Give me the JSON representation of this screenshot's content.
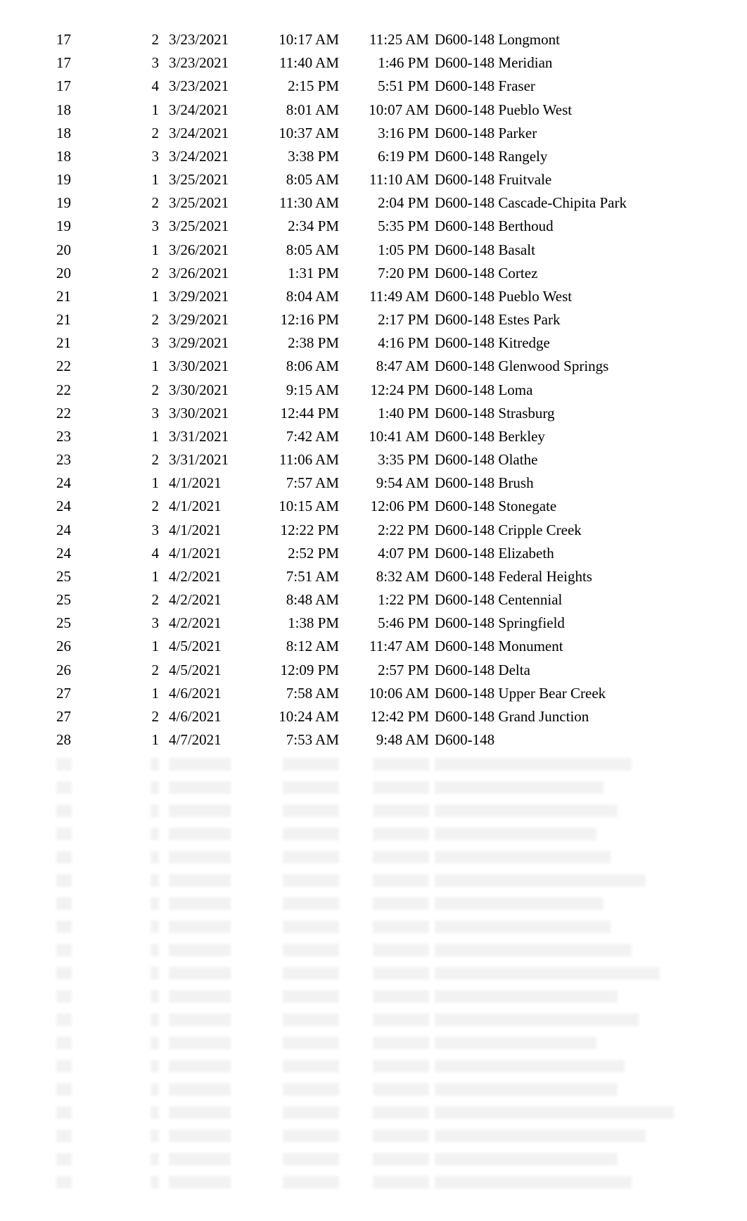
{
  "rows": [
    {
      "a": "17",
      "b": "2",
      "c": "3/23/2021",
      "d": "10:17 AM",
      "e": "11:25 AM",
      "f": "D600-148 Longmont"
    },
    {
      "a": "17",
      "b": "3",
      "c": "3/23/2021",
      "d": "11:40 AM",
      "e": "1:46 PM",
      "f": "D600-148 Meridian"
    },
    {
      "a": "17",
      "b": "4",
      "c": "3/23/2021",
      "d": "2:15 PM",
      "e": "5:51 PM",
      "f": "D600-148 Fraser"
    },
    {
      "a": "18",
      "b": "1",
      "c": "3/24/2021",
      "d": "8:01 AM",
      "e": "10:07 AM",
      "f": "D600-148 Pueblo West"
    },
    {
      "a": "18",
      "b": "2",
      "c": "3/24/2021",
      "d": "10:37 AM",
      "e": "3:16 PM",
      "f": "D600-148 Parker"
    },
    {
      "a": "18",
      "b": "3",
      "c": "3/24/2021",
      "d": "3:38 PM",
      "e": "6:19 PM",
      "f": "D600-148 Rangely"
    },
    {
      "a": "19",
      "b": "1",
      "c": "3/25/2021",
      "d": "8:05 AM",
      "e": "11:10 AM",
      "f": "D600-148 Fruitvale"
    },
    {
      "a": "19",
      "b": "2",
      "c": "3/25/2021",
      "d": "11:30 AM",
      "e": "2:04 PM",
      "f": "D600-148 Cascade-Chipita Park"
    },
    {
      "a": "19",
      "b": "3",
      "c": "3/25/2021",
      "d": "2:34 PM",
      "e": "5:35 PM",
      "f": "D600-148 Berthoud"
    },
    {
      "a": "20",
      "b": "1",
      "c": "3/26/2021",
      "d": "8:05 AM",
      "e": "1:05 PM",
      "f": "D600-148 Basalt"
    },
    {
      "a": "20",
      "b": "2",
      "c": "3/26/2021",
      "d": "1:31 PM",
      "e": "7:20 PM",
      "f": "D600-148 Cortez"
    },
    {
      "a": "21",
      "b": "1",
      "c": "3/29/2021",
      "d": "8:04 AM",
      "e": "11:49 AM",
      "f": "D600-148 Pueblo West"
    },
    {
      "a": "21",
      "b": "2",
      "c": "3/29/2021",
      "d": "12:16 PM",
      "e": "2:17 PM",
      "f": "D600-148 Estes Park"
    },
    {
      "a": "21",
      "b": "3",
      "c": "3/29/2021",
      "d": "2:38 PM",
      "e": "4:16 PM",
      "f": "D600-148 Kitredge"
    },
    {
      "a": "22",
      "b": "1",
      "c": "3/30/2021",
      "d": "8:06 AM",
      "e": "8:47 AM",
      "f": "D600-148 Glenwood Springs"
    },
    {
      "a": "22",
      "b": "2",
      "c": "3/30/2021",
      "d": "9:15 AM",
      "e": "12:24 PM",
      "f": "D600-148 Loma"
    },
    {
      "a": "22",
      "b": "3",
      "c": "3/30/2021",
      "d": "12:44 PM",
      "e": "1:40 PM",
      "f": "D600-148 Strasburg"
    },
    {
      "a": "23",
      "b": "1",
      "c": "3/31/2021",
      "d": "7:42 AM",
      "e": "10:41 AM",
      "f": "D600-148 Berkley"
    },
    {
      "a": "23",
      "b": "2",
      "c": "3/31/2021",
      "d": "11:06 AM",
      "e": "3:35 PM",
      "f": "D600-148 Olathe"
    },
    {
      "a": "24",
      "b": "1",
      "c": "4/1/2021",
      "d": "7:57 AM",
      "e": "9:54 AM",
      "f": "D600-148 Brush"
    },
    {
      "a": "24",
      "b": "2",
      "c": "4/1/2021",
      "d": "10:15 AM",
      "e": "12:06 PM",
      "f": "D600-148 Stonegate"
    },
    {
      "a": "24",
      "b": "3",
      "c": "4/1/2021",
      "d": "12:22 PM",
      "e": "2:22 PM",
      "f": "D600-148 Cripple Creek"
    },
    {
      "a": "24",
      "b": "4",
      "c": "4/1/2021",
      "d": "2:52 PM",
      "e": "4:07 PM",
      "f": "D600-148 Elizabeth"
    },
    {
      "a": "25",
      "b": "1",
      "c": "4/2/2021",
      "d": "7:51 AM",
      "e": "8:32 AM",
      "f": "D600-148 Federal Heights"
    },
    {
      "a": "25",
      "b": "2",
      "c": "4/2/2021",
      "d": "8:48 AM",
      "e": "1:22 PM",
      "f": "D600-148 Centennial"
    },
    {
      "a": "25",
      "b": "3",
      "c": "4/2/2021",
      "d": "1:38 PM",
      "e": "5:46 PM",
      "f": "D600-148 Springfield"
    },
    {
      "a": "26",
      "b": "1",
      "c": "4/5/2021",
      "d": "8:12 AM",
      "e": "11:47 AM",
      "f": "D600-148 Monument"
    },
    {
      "a": "26",
      "b": "2",
      "c": "4/5/2021",
      "d": "12:09 PM",
      "e": "2:57 PM",
      "f": "D600-148 Delta"
    },
    {
      "a": "27",
      "b": "1",
      "c": "4/6/2021",
      "d": "7:58 AM",
      "e": "10:06 AM",
      "f": "D600-148 Upper Bear Creek"
    },
    {
      "a": "27",
      "b": "2",
      "c": "4/6/2021",
      "d": "10:24 AM",
      "e": "12:42 PM",
      "f": "D600-148 Grand Junction"
    },
    {
      "a": "28",
      "b": "1",
      "c": "4/7/2021",
      "d": "7:53 AM",
      "e": "9:48 AM",
      "f": "D600-148"
    }
  ],
  "redacted_rows": 19,
  "redacted_bar_widths": {
    "a": 22,
    "b": 12,
    "c": 88,
    "d": 80,
    "e": 80,
    "f": [
      280,
      240,
      260,
      230,
      250,
      300,
      240,
      250,
      280,
      320,
      260,
      290,
      230,
      270,
      260,
      340,
      300,
      260,
      280
    ]
  }
}
